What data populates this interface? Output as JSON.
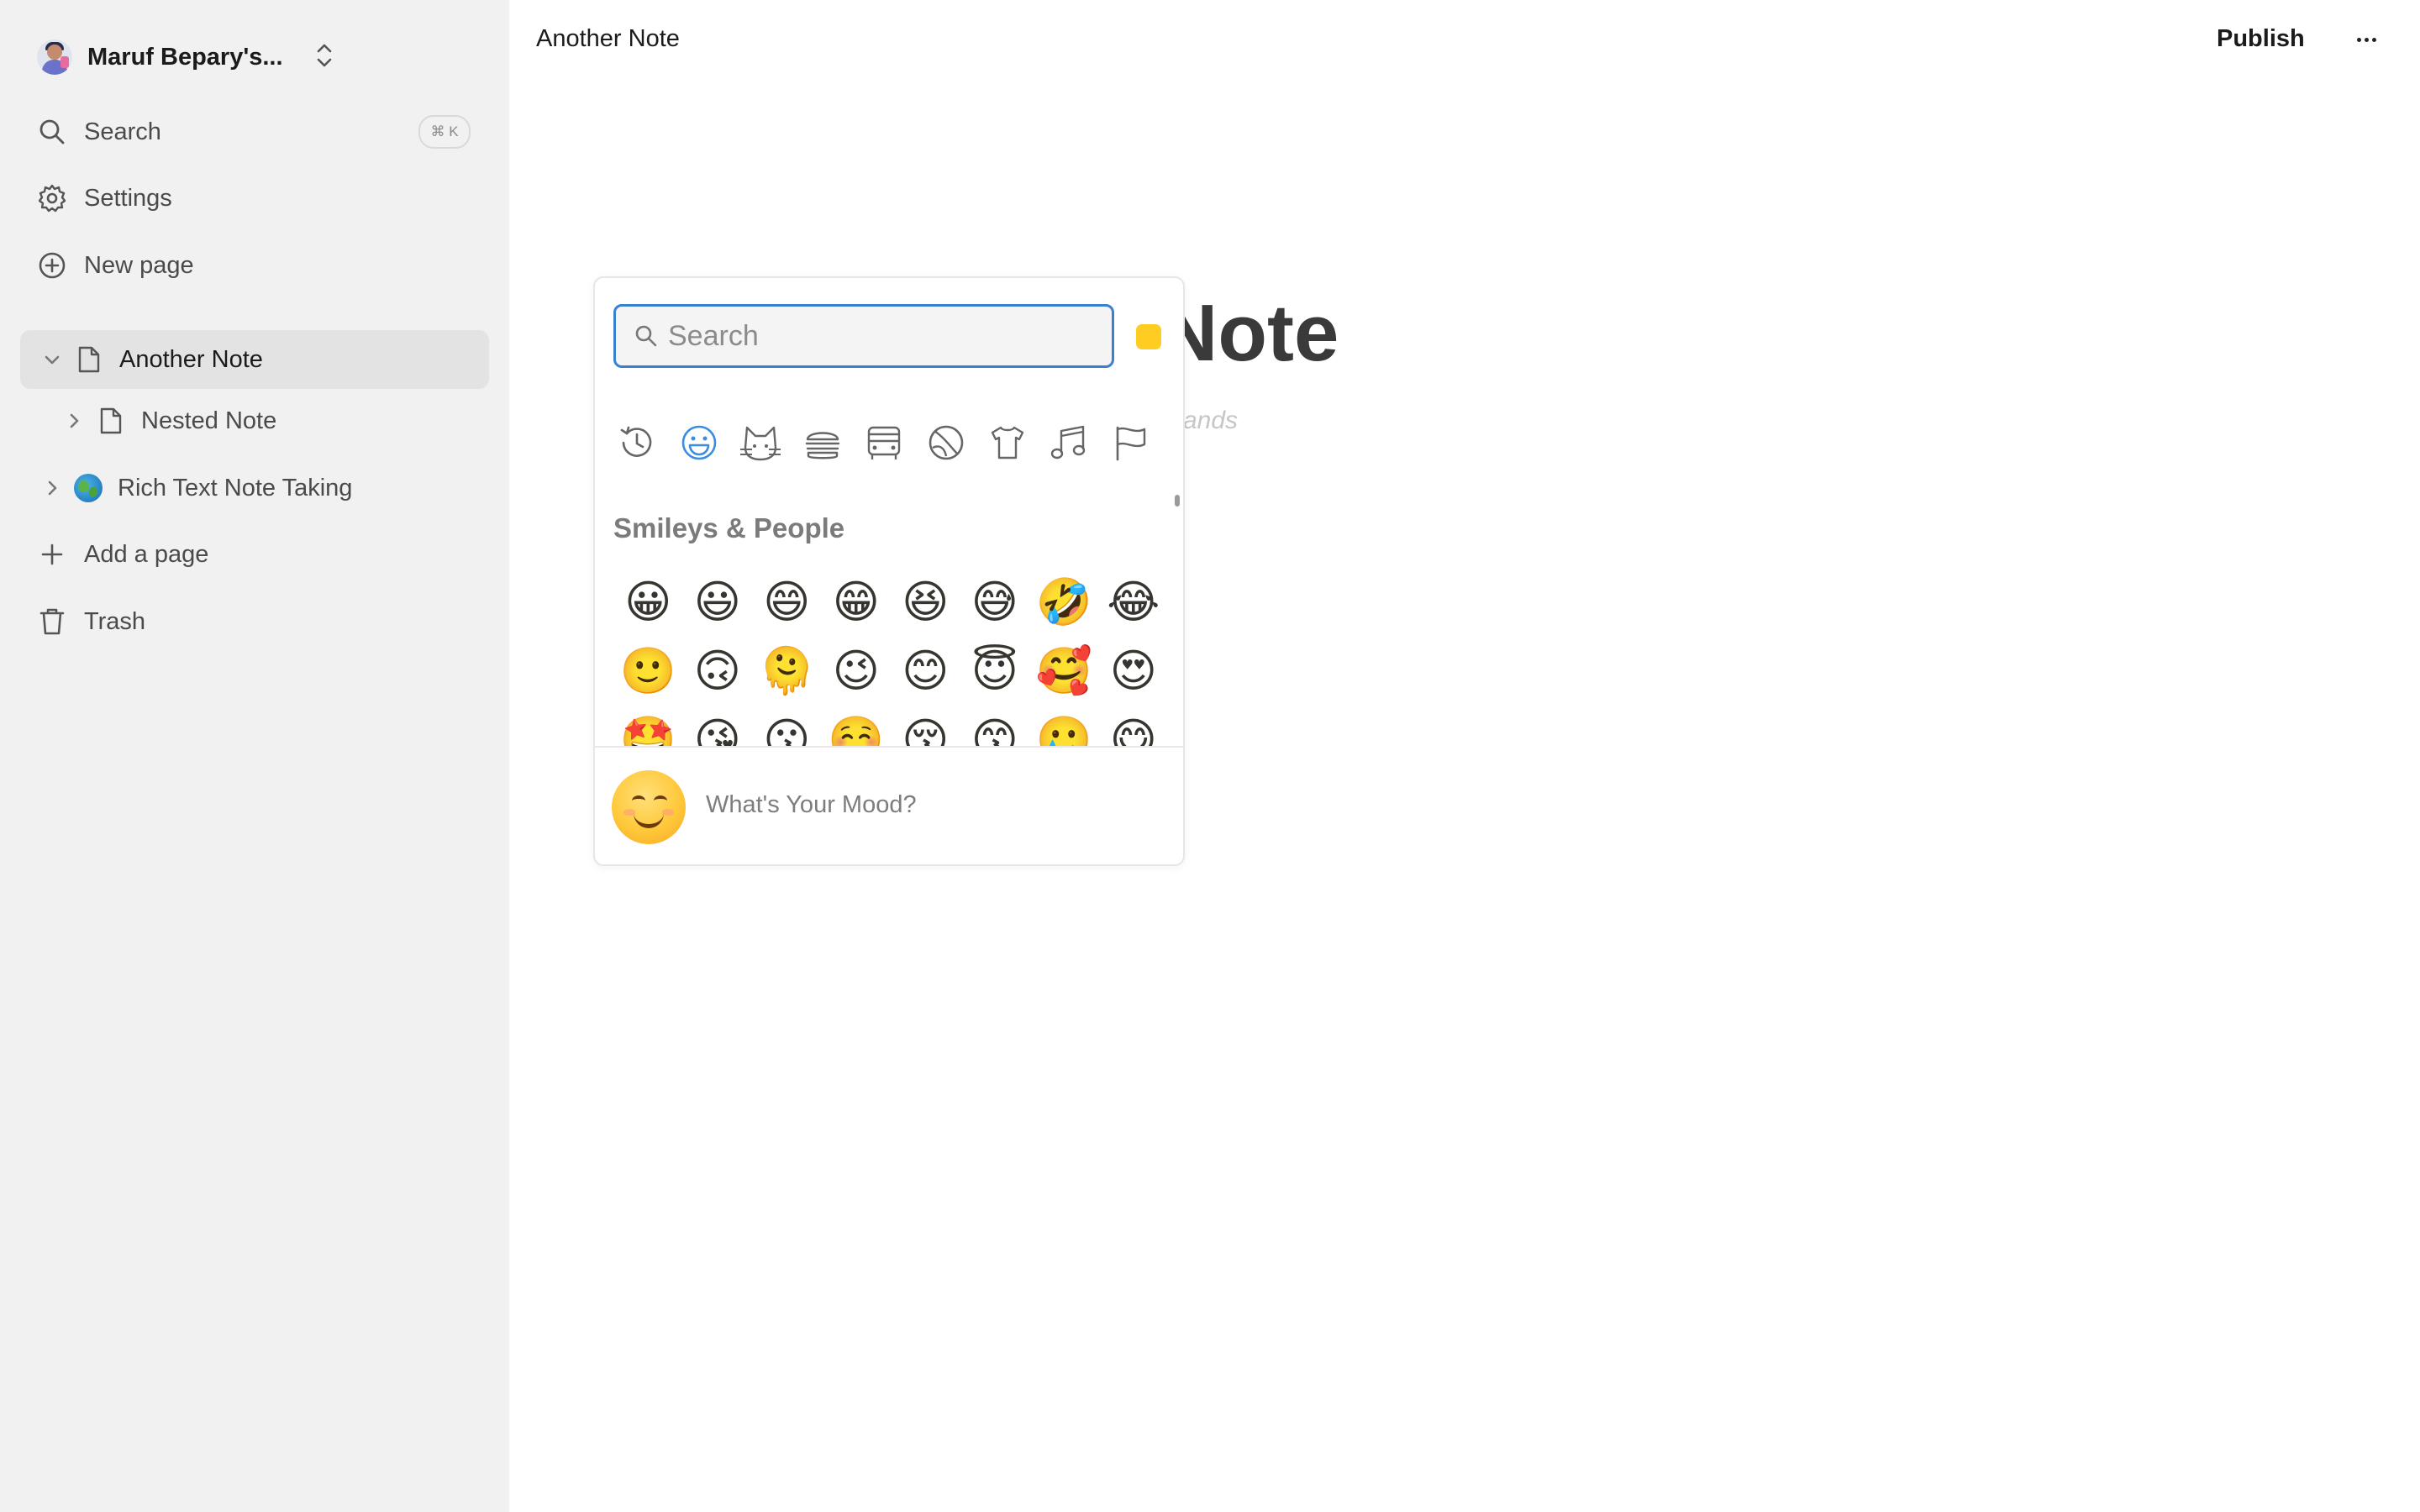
{
  "sidebar": {
    "workspace_name": "Maruf Bepary's...",
    "search_label": "Search",
    "search_shortcut": "⌘ K",
    "settings_label": "Settings",
    "new_page_label": "New page",
    "pages": [
      {
        "label": "Another Note"
      },
      {
        "label": "Nested Note"
      },
      {
        "label": "Rich Text Note Taking"
      }
    ],
    "add_page_label": "Add a page",
    "trash_label": "Trash"
  },
  "header": {
    "title": "Another Note",
    "publish_label": "Publish"
  },
  "document": {
    "title_visible": "Note",
    "subtitle_visible": "ands"
  },
  "emoji_picker": {
    "search_placeholder": "Search",
    "skin_tone_color": "#ffcc22",
    "categories": [
      "recent-icon",
      "smileys-icon",
      "animals-icon",
      "food-icon",
      "travel-icon",
      "activities-icon",
      "objects-icon",
      "symbols-icon",
      "flags-icon"
    ],
    "section_title": "Smileys & People",
    "emojis": [
      "😀",
      "😃",
      "😄",
      "😁",
      "😆",
      "😅",
      "🤣",
      "😂",
      "🙂",
      "🙃",
      "🫠",
      "😉",
      "😊",
      "😇",
      "🥰",
      "😍",
      "🤩",
      "😘",
      "😗",
      "☺️",
      "😚",
      "😙",
      "🥲",
      "😋"
    ],
    "mood_placeholder": "What's Your Mood?"
  },
  "colors": {
    "sidebar_bg": "#f1f1f1",
    "accent": "#3b7fd0"
  }
}
